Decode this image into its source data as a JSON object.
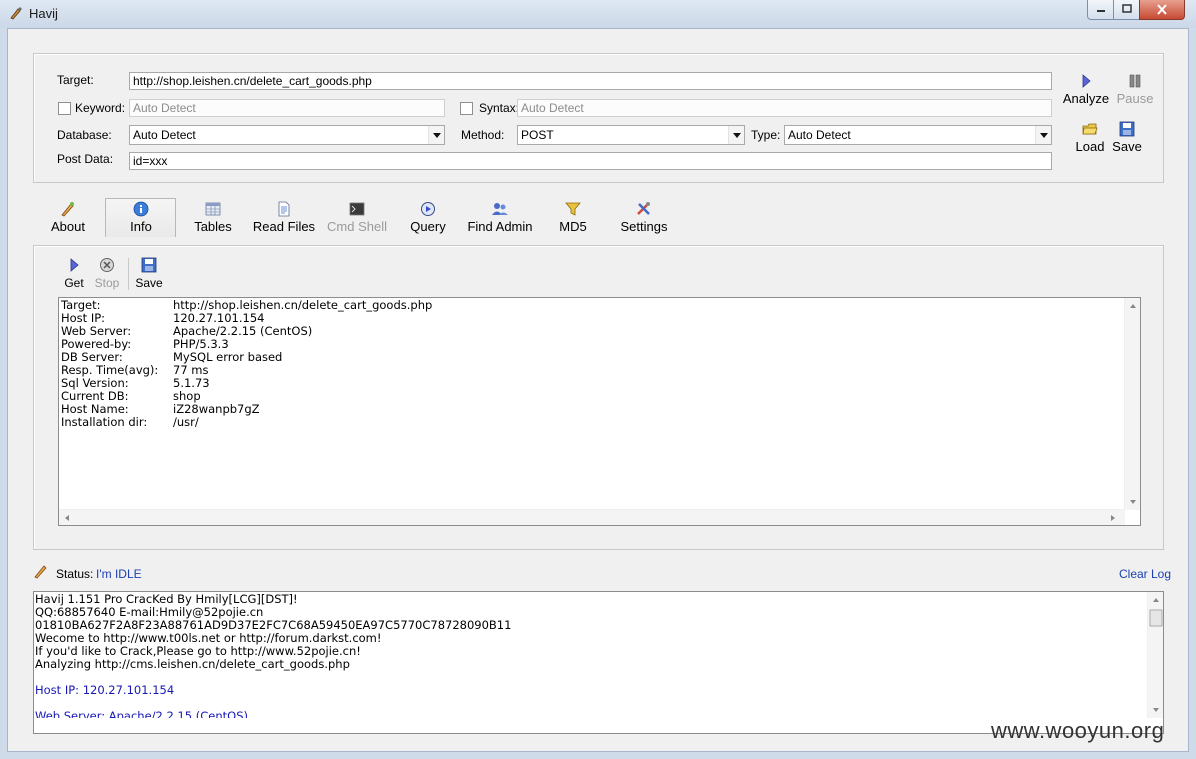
{
  "window": {
    "title": "Havij"
  },
  "form": {
    "target_label": "Target:",
    "target_value": "http://shop.leishen.cn/delete_cart_goods.php",
    "keyword_label": "Keyword:",
    "keyword_placeholder": "Auto Detect",
    "syntax_label": "Syntax:",
    "syntax_placeholder": "Auto Detect",
    "database_label": "Database:",
    "database_value": "Auto Detect",
    "method_label": "Method:",
    "method_value": "POST",
    "type_label": "Type:",
    "type_value": "Auto Detect",
    "postdata_label": "Post Data:",
    "postdata_value": "id=xxx"
  },
  "actions": {
    "analyze": "Analyze",
    "pause": "Pause",
    "load": "Load",
    "save": "Save"
  },
  "tabs": [
    {
      "label": "About"
    },
    {
      "label": "Info"
    },
    {
      "label": "Tables"
    },
    {
      "label": "Read Files"
    },
    {
      "label": "Cmd Shell"
    },
    {
      "label": "Query"
    },
    {
      "label": "Find Admin"
    },
    {
      "label": "MD5"
    },
    {
      "label": "Settings"
    }
  ],
  "info_toolbar": {
    "get": "Get",
    "stop": "Stop",
    "save": "Save"
  },
  "info_rows": [
    {
      "key": "Target:",
      "value": "http://shop.leishen.cn/delete_cart_goods.php"
    },
    {
      "key": "Host IP:",
      "value": "120.27.101.154"
    },
    {
      "key": "Web Server:",
      "value": "Apache/2.2.15 (CentOS)"
    },
    {
      "key": "Powered-by:",
      "value": "PHP/5.3.3"
    },
    {
      "key": "DB Server:",
      "value": "MySQL error based"
    },
    {
      "key": "Resp. Time(avg):",
      "value": "77 ms"
    },
    {
      "key": "Sql Version:",
      "value": "5.1.73"
    },
    {
      "key": "Current DB:",
      "value": "shop"
    },
    {
      "key": "Host Name:",
      "value": "iZ28wanpb7gZ"
    },
    {
      "key": "Installation dir:",
      "value": "/usr/"
    }
  ],
  "status": {
    "label": "Status:",
    "value": "I'm IDLE",
    "clear_log": "Clear Log"
  },
  "log": [
    {
      "text": "Havij 1.151 Pro CracKed By Hmily[LCG][DST]!",
      "blue": false
    },
    {
      "text": "QQ:68857640   E-mail:Hmily@52pojie.cn",
      "blue": false
    },
    {
      "text": "01810BA627F2A8F23A88761AD9D37E2FC7C68A59450EA97C5770C78728090B11",
      "blue": false
    },
    {
      "text": "Wecome to http://www.t00ls.net or http://forum.darkst.com!",
      "blue": false
    },
    {
      "text": "If you'd like to Crack,Please go to http://www.52pojie.cn!",
      "blue": false
    },
    {
      "text": "Analyzing http://cms.leishen.cn/delete_cart_goods.php",
      "blue": false
    },
    {
      "text": "",
      "blue": false
    },
    {
      "text": "Host IP: 120.27.101.154",
      "blue": true
    },
    {
      "text": "",
      "blue": false
    },
    {
      "text": "Web Server: Apache/2.2.15 (CentOS)",
      "blue": true
    }
  ],
  "watermark": "www.wooyun.org",
  "colors": {
    "link": "#1a3fb3",
    "log_blue": "#1717b6",
    "close": "#c74a33"
  }
}
